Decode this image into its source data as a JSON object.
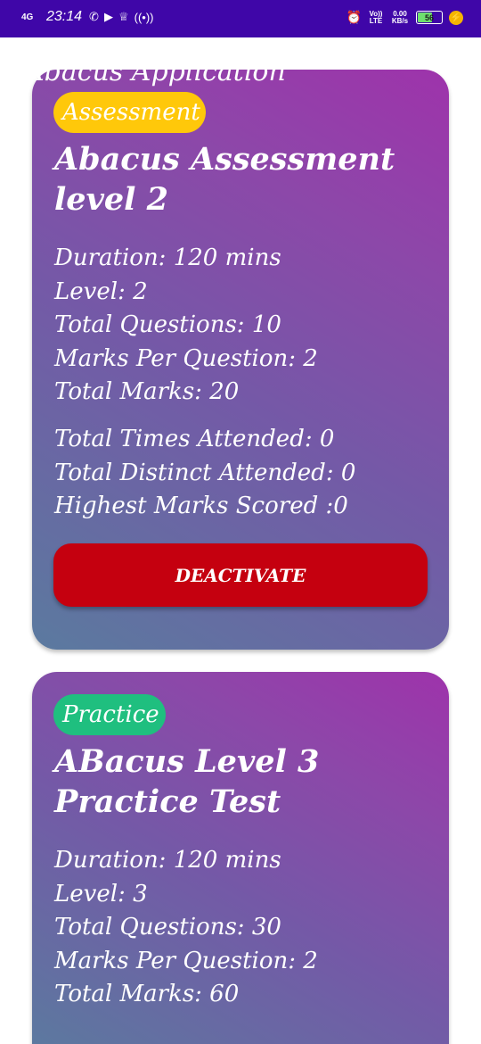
{
  "status_bar": {
    "network": "4G",
    "time": "23:14",
    "icons": [
      "whatsapp-icon",
      "youtube-icon",
      "trophy-icon",
      "hotspot-icon"
    ],
    "volte": "Vo)) LTE",
    "speed": "0.00 KB/s",
    "battery": "56",
    "battery_level": 0.56
  },
  "app_title": "Abacus Application",
  "cards": [
    {
      "badge": "Assessment",
      "badge_color": "#ffc80a",
      "title": "Abacus Assessment level 2",
      "duration": "Duration: 120 mins",
      "level": "Level: 2",
      "total_questions": "Total Questions: 10",
      "marks_per_question": "Marks Per Question: 2",
      "total_marks": "Total Marks: 20",
      "times_attended": "Total Times Attended: 0",
      "distinct_attended": "Total Distinct Attended: 0",
      "highest_marks": "Highest Marks Scored :0",
      "button_label": "DEACTIVATE",
      "button_color": "#c5000f"
    },
    {
      "badge": "Practice",
      "badge_color": "#1fbf7f",
      "title": "ABacus Level 3 Practice Test",
      "duration": "Duration: 120 mins",
      "level": "Level: 3",
      "total_questions": "Total Questions: 30",
      "marks_per_question": "Marks Per Question: 2",
      "total_marks": "Total Marks: 60"
    }
  ],
  "colors": {
    "status_bar": "#3f06a8",
    "card_gradient_start": "#5b7a9f",
    "card_gradient_end": "#9e33ab"
  }
}
